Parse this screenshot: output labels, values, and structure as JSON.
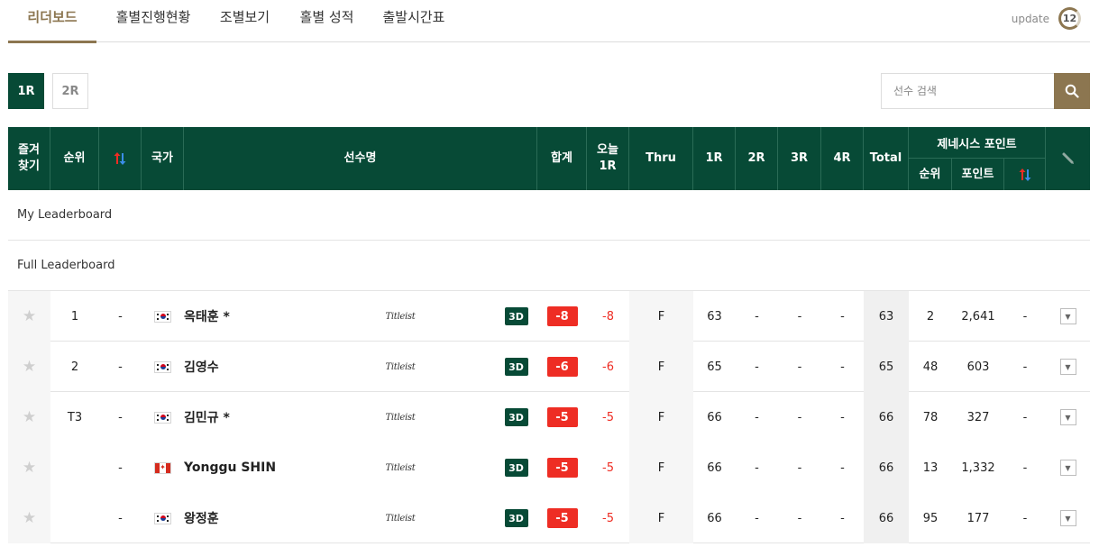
{
  "tabs": [
    {
      "label": "리더보드",
      "active": true
    },
    {
      "label": "홀별진행현황",
      "active": false
    },
    {
      "label": "조별보기",
      "active": false
    },
    {
      "label": "홀별 성적",
      "active": false
    },
    {
      "label": "출발시간표",
      "active": false
    }
  ],
  "update": {
    "label": "update",
    "countdown": "12"
  },
  "rounds": [
    {
      "label": "1R",
      "active": true
    },
    {
      "label": "2R",
      "active": false
    }
  ],
  "search": {
    "placeholder": "선수 검색",
    "icon": "search-icon"
  },
  "headers": {
    "favorite": "즐겨\n찾기",
    "rank": "순위",
    "move_icon": "up-down-arrows-icon",
    "country": "국가",
    "player": "선수명",
    "total_to_par": "합계",
    "today": "오늘\n1R",
    "thru": "Thru",
    "r1": "1R",
    "r2": "2R",
    "r3": "3R",
    "r4": "4R",
    "total": "Total",
    "genesis": "제네시스 포인트",
    "genesis_rank": "순위",
    "genesis_points": "포인트",
    "genesis_move_icon": "up-down-arrows-icon",
    "tool_icon": "pen-icon"
  },
  "sections": {
    "my": "My Leaderboard",
    "full": "Full Leaderboard"
  },
  "colors": {
    "primary": "#074a36",
    "accent": "#8c7650",
    "score_red": "#ee2d24"
  },
  "players": [
    {
      "rank": "1",
      "move": "-",
      "country": "KR",
      "name": "옥태훈 *",
      "brand": "Titleist",
      "view3d": "3D",
      "total": "-8",
      "today": "-8",
      "thru": "F",
      "r1": "63",
      "r2": "-",
      "r3": "-",
      "r4": "-",
      "total_strokes": "63",
      "genesis_rank": "2",
      "genesis_points": "2,641",
      "genesis_move": "-"
    },
    {
      "rank": "2",
      "move": "-",
      "country": "KR",
      "name": "김영수",
      "brand": "Titleist",
      "view3d": "3D",
      "total": "-6",
      "today": "-6",
      "thru": "F",
      "r1": "65",
      "r2": "-",
      "r3": "-",
      "r4": "-",
      "total_strokes": "65",
      "genesis_rank": "48",
      "genesis_points": "603",
      "genesis_move": "-"
    },
    {
      "rank": "T3",
      "move": "-",
      "country": "KR",
      "name": "김민규 *",
      "brand": "Titleist",
      "view3d": "3D",
      "total": "-5",
      "today": "-5",
      "thru": "F",
      "r1": "66",
      "r2": "-",
      "r3": "-",
      "r4": "-",
      "total_strokes": "66",
      "genesis_rank": "78",
      "genesis_points": "327",
      "genesis_move": "-"
    },
    {
      "rank": "",
      "move": "-",
      "country": "CA",
      "name": "Yonggu SHIN",
      "brand": "Titleist",
      "view3d": "3D",
      "total": "-5",
      "today": "-5",
      "thru": "F",
      "r1": "66",
      "r2": "-",
      "r3": "-",
      "r4": "-",
      "total_strokes": "66",
      "genesis_rank": "13",
      "genesis_points": "1,332",
      "genesis_move": "-"
    },
    {
      "rank": "",
      "move": "-",
      "country": "KR",
      "name": "왕정훈",
      "brand": "Titleist",
      "view3d": "3D",
      "total": "-5",
      "today": "-5",
      "thru": "F",
      "r1": "66",
      "r2": "-",
      "r3": "-",
      "r4": "-",
      "total_strokes": "66",
      "genesis_rank": "95",
      "genesis_points": "177",
      "genesis_move": "-"
    }
  ]
}
